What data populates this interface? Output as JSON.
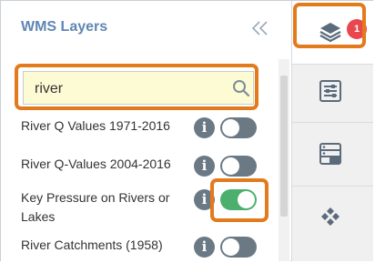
{
  "panel": {
    "title": "WMS Layers",
    "collapse_icon": "double-chevron-left-icon",
    "search": {
      "value": "river",
      "placeholder": "",
      "icon": "search-icon"
    }
  },
  "layers": [
    {
      "label": "River Q Values 1971-2016",
      "info": "i",
      "enabled": false
    },
    {
      "label": "River Q-Values 2004-2016",
      "info": "i",
      "enabled": false
    },
    {
      "label_line1": "Key Pressure on Rivers or",
      "label_line2": "Lakes",
      "info": "i",
      "enabled": true
    },
    {
      "label": "River Catchments (1958)",
      "info": "i",
      "enabled": false
    }
  ],
  "rail": {
    "items": [
      {
        "name": "layers",
        "icon": "layers-icon",
        "badge": "1",
        "active": true
      },
      {
        "name": "filters",
        "icon": "sliders-icon",
        "active": false
      },
      {
        "name": "data",
        "icon": "database-list-icon",
        "active": false
      },
      {
        "name": "basemaps",
        "icon": "diamond-grid-icon",
        "active": false
      }
    ]
  },
  "colors": {
    "title": "#5f87b3",
    "highlight": "#e37a1c",
    "toggle_on": "#4caf6d",
    "toggle_off": "#6b7985",
    "badge": "#e8474e",
    "search_bg": "#fdfbd4"
  }
}
